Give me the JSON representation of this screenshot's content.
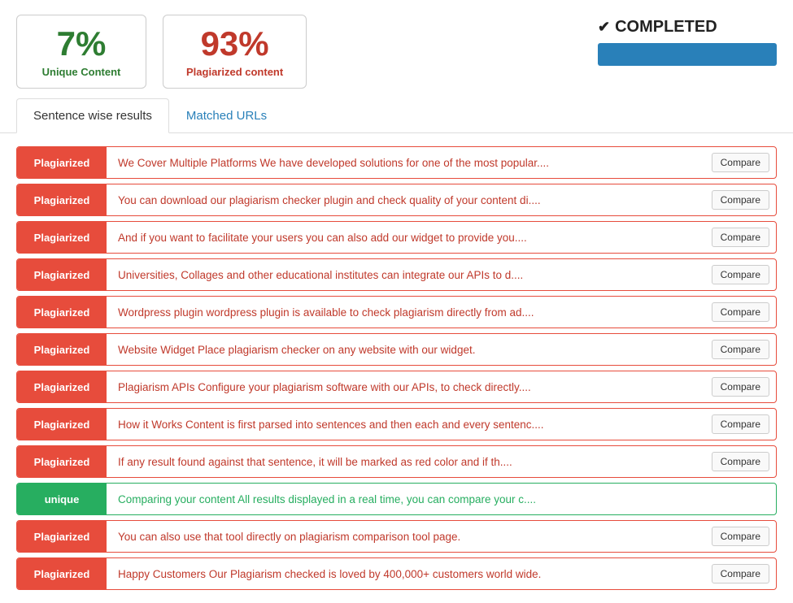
{
  "stats": {
    "unique_percent": "7%",
    "unique_label": "Unique Content",
    "plagiarized_percent": "93%",
    "plagiarized_label": "Plagiarized content"
  },
  "completed": {
    "label": "COMPLETED"
  },
  "tabs": [
    {
      "id": "sentence",
      "label": "Sentence wise results",
      "active": true
    },
    {
      "id": "urls",
      "label": "Matched URLs",
      "active": false
    }
  ],
  "compare_btn_label": "Compare",
  "results": [
    {
      "status": "Plagiarized",
      "unique": false,
      "text": "We Cover Multiple Platforms We have developed solutions for one of the most popular...."
    },
    {
      "status": "Plagiarized",
      "unique": false,
      "text": "You can download our plagiarism checker plugin and check quality of your content di...."
    },
    {
      "status": "Plagiarized",
      "unique": false,
      "text": "And if you want to facilitate your users you can also add our widget to provide you...."
    },
    {
      "status": "Plagiarized",
      "unique": false,
      "text": "Universities, Collages and other educational institutes can integrate our APIs to d...."
    },
    {
      "status": "Plagiarized",
      "unique": false,
      "text": "Wordpress plugin wordpress plugin is available to check plagiarism directly from ad...."
    },
    {
      "status": "Plagiarized",
      "unique": false,
      "text": "Website Widget Place plagiarism checker on any website with our widget."
    },
    {
      "status": "Plagiarized",
      "unique": false,
      "text": "Plagiarism APIs Configure your plagiarism software with our APIs, to check directly...."
    },
    {
      "status": "Plagiarized",
      "unique": false,
      "text": "How it Works Content is first parsed into sentences and then each and every sentenc...."
    },
    {
      "status": "Plagiarized",
      "unique": false,
      "text": "If any result found against that sentence, it will be marked as red color and if th...."
    },
    {
      "status": "unique",
      "unique": true,
      "text": "Comparing your content All results displayed in a real time, you can compare your c...."
    },
    {
      "status": "Plagiarized",
      "unique": false,
      "text": "You can also use that tool directly on plagiarism comparison tool page."
    },
    {
      "status": "Plagiarized",
      "unique": false,
      "text": "Happy Customers Our Plagiarism checked is loved by 400,000+ customers world wide."
    }
  ]
}
